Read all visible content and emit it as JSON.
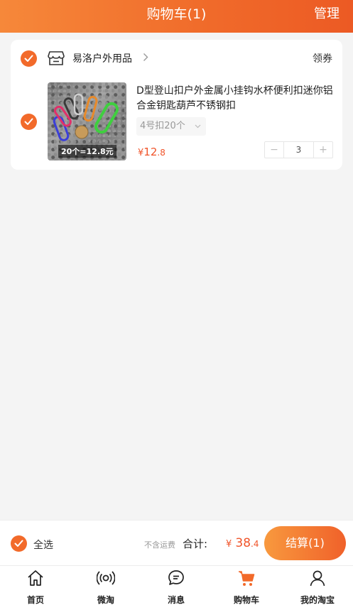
{
  "header": {
    "title": "购物车(1)",
    "manage_label": "管理"
  },
  "shop": {
    "name": "易洛户外用品",
    "coupon_label": "领券",
    "checked": true
  },
  "item": {
    "checked": true,
    "image_caption": "20个=12.8元",
    "title": "D型登山扣户外金属小挂钩水杯便利扣迷你铝合金钥匙葫芦不锈钢扣",
    "sku": "4号扣20个",
    "price_symbol": "¥",
    "price_int": "12",
    "price_dec": ".8",
    "quantity": "3",
    "minus": "−",
    "plus": "+"
  },
  "checkout": {
    "select_all_label": "全选",
    "shipping_note": "不含运费",
    "total_label": "合计:",
    "total_symbol": "¥",
    "total_int": "38",
    "total_dec": ".4",
    "settle_label": "结算(1)"
  },
  "tabbar": {
    "items": [
      {
        "label": "首页",
        "icon": "home-icon"
      },
      {
        "label": "微淘",
        "icon": "broadcast-icon"
      },
      {
        "label": "消息",
        "icon": "message-icon"
      },
      {
        "label": "购物车",
        "icon": "cart-icon",
        "active": true
      },
      {
        "label": "我的淘宝",
        "icon": "profile-icon"
      }
    ]
  },
  "colors": {
    "accent": "#f26a2a",
    "price": "#f0542a",
    "header_gradient_start": "#f6883a",
    "header_gradient_end": "#ec5a24"
  }
}
